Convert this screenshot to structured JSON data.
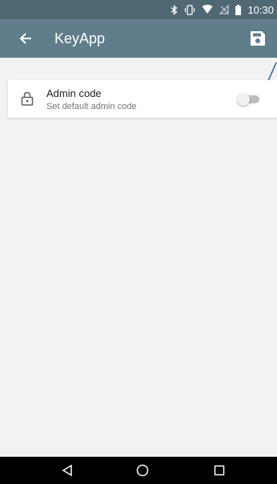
{
  "status_bar": {
    "time": "10:30",
    "icons": [
      "bluetooth-icon",
      "vibrate-icon",
      "wifi-icon",
      "no-sim-icon",
      "battery-icon"
    ]
  },
  "app_bar": {
    "title": "KeyApp",
    "back_icon": "arrow-back-icon",
    "save_icon": "save-icon",
    "color": "#607d8b"
  },
  "settings": [
    {
      "icon": "lock-icon",
      "title": "Admin code",
      "subtitle": "Set default admin code",
      "enabled": false
    }
  ],
  "nav_bar": {
    "buttons": [
      "back-triangle-icon",
      "home-circle-icon",
      "recents-square-icon"
    ]
  },
  "colors": {
    "status_bar": "#4f6874",
    "app_bar": "#607d8b",
    "background": "#f2f2f2",
    "accent_line": "#3d6a9a"
  }
}
